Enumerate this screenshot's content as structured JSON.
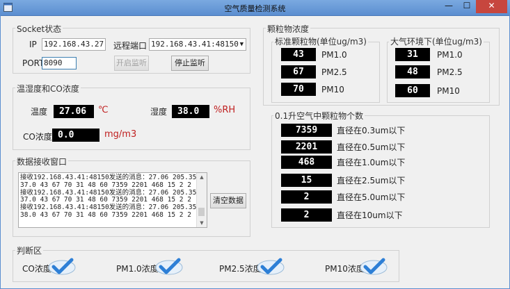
{
  "window": {
    "title": "空气质量检测系统",
    "min": "—",
    "max": "☐",
    "close": "✕"
  },
  "socket": {
    "title": "Socket状态",
    "ip_label": "IP",
    "ip_value": "192.168.43.27",
    "remote_label": "远程端口",
    "remote_value": "192.168.43.41:48150",
    "port_label": "PORT",
    "port_value": "8090",
    "start_btn": "开启监听",
    "stop_btn": "停止监听"
  },
  "th": {
    "title": "温湿度和CO浓度",
    "temp_label": "温度",
    "temp_value": "27.06",
    "temp_unit": "℃",
    "hum_label": "湿度",
    "hum_value": "38.0",
    "hum_unit": "%RH",
    "co_label": "CO浓度",
    "co_value": "0.0",
    "co_unit": "mg/m3"
  },
  "recv": {
    "title": "数据接收窗口",
    "lines": "接收192.168.43.41:48150发送的消息：27.06 205.35\n37.0 43 67 70 31 48 60 7359 2201 468 15 2 2\n接收192.168.43.41:48150发送的消息：27.06 205.35\n37.0 43 67 70 31 48 60 7359 2201 468 15 2 2\n接收192.168.43.41:48150发送的消息：27.06 205.35\n38.0 43 67 70 31 48 60 7359 2201 468 15 2 2",
    "clear_btn": "清空数据"
  },
  "pm": {
    "title": "颗粒物浓度",
    "std_title": "标准颗粒物(单位ug/m3)",
    "std": [
      {
        "value": "43",
        "label": "PM1.0"
      },
      {
        "value": "67",
        "label": "PM2.5"
      },
      {
        "value": "70",
        "label": "PM10"
      }
    ],
    "env_title": "大气环境下(单位ug/m3)",
    "env": [
      {
        "value": "31",
        "label": "PM1.0"
      },
      {
        "value": "48",
        "label": "PM2.5"
      },
      {
        "value": "60",
        "label": "PM10"
      }
    ]
  },
  "count": {
    "title": "0.1升空气中颗粒物个数",
    "rows": [
      {
        "value": "7359",
        "label": "直径在0.3um以下"
      },
      {
        "value": "2201",
        "label": "直径在0.5um以下"
      },
      {
        "value": "468",
        "label": "直径在1.0um以下"
      },
      {
        "value": "15",
        "label": "直径在2.5um以下"
      },
      {
        "value": "2",
        "label": "直径在5.0um以下"
      },
      {
        "value": "2",
        "label": "直径在10um以下"
      }
    ]
  },
  "judge": {
    "title": "判断区",
    "items": [
      {
        "label": "CO浓度"
      },
      {
        "label": "PM1.0浓度"
      },
      {
        "label": "PM2.5浓度"
      },
      {
        "label": "PM10浓度"
      }
    ]
  }
}
